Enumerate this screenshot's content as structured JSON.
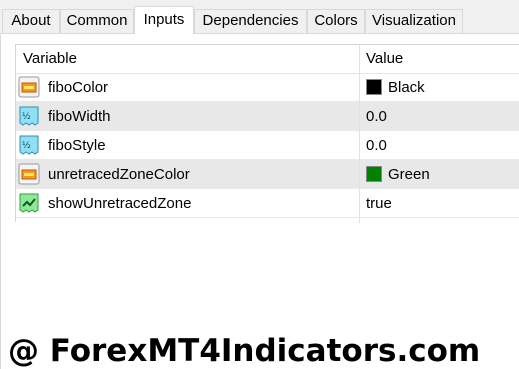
{
  "tabs": [
    {
      "label": "About"
    },
    {
      "label": "Common"
    },
    {
      "label": "Inputs",
      "active": true
    },
    {
      "label": "Dependencies"
    },
    {
      "label": "Colors"
    },
    {
      "label": "Visualization"
    }
  ],
  "table": {
    "columns": [
      "Variable",
      "Value"
    ],
    "rows": [
      {
        "icon": "color-param-icon",
        "variable": "fiboColor",
        "value": "Black",
        "swatch": "#000000"
      },
      {
        "icon": "double-param-icon",
        "variable": "fiboWidth",
        "value": "0.0"
      },
      {
        "icon": "double-param-icon",
        "variable": "fiboStyle",
        "value": "0.0"
      },
      {
        "icon": "color-param-icon",
        "variable": "unretracedZoneColor",
        "value": "Green",
        "swatch": "#008000"
      },
      {
        "icon": "bool-param-icon",
        "variable": "showUnretracedZone",
        "value": "true"
      }
    ]
  },
  "watermark": {
    "text": "@ ForexMT4Indicators.com"
  }
}
